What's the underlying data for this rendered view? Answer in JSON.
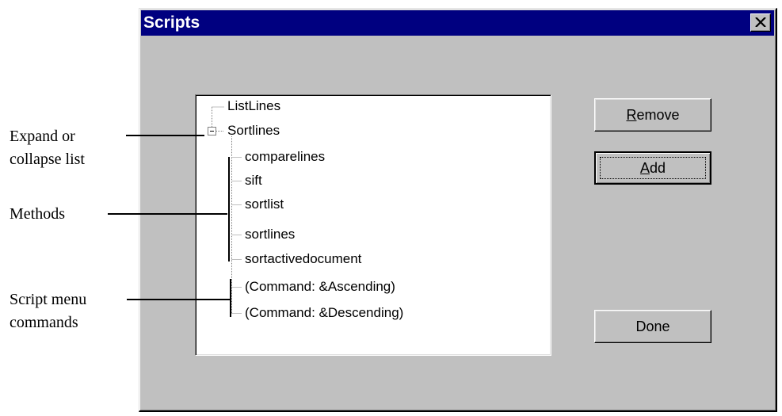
{
  "dialog": {
    "title": "Scripts",
    "close_icon": "close-icon"
  },
  "tree": {
    "items": [
      {
        "label": "ListLines",
        "level": 0
      },
      {
        "label": "Sortlines",
        "level": 0,
        "expanded": true
      },
      {
        "label": "comparelines",
        "level": 1
      },
      {
        "label": "sift",
        "level": 1
      },
      {
        "label": "sortlist",
        "level": 1
      },
      {
        "label": "sortlines",
        "level": 1
      },
      {
        "label": "sortactivedocument",
        "level": 1
      },
      {
        "label": "(Command: &Ascending)",
        "level": 1
      },
      {
        "label": "(Command: &Descending)",
        "level": 1
      }
    ]
  },
  "buttons": {
    "remove": {
      "mnemonic": "R",
      "rest": "emove"
    },
    "add": {
      "mnemonic": "A",
      "rest": "dd"
    },
    "done": {
      "label": "Done"
    }
  },
  "callouts": {
    "expand_line1": "Expand or",
    "expand_line2": "collapse list",
    "methods": "Methods",
    "script_line1": "Script menu",
    "script_line2": "commands"
  }
}
